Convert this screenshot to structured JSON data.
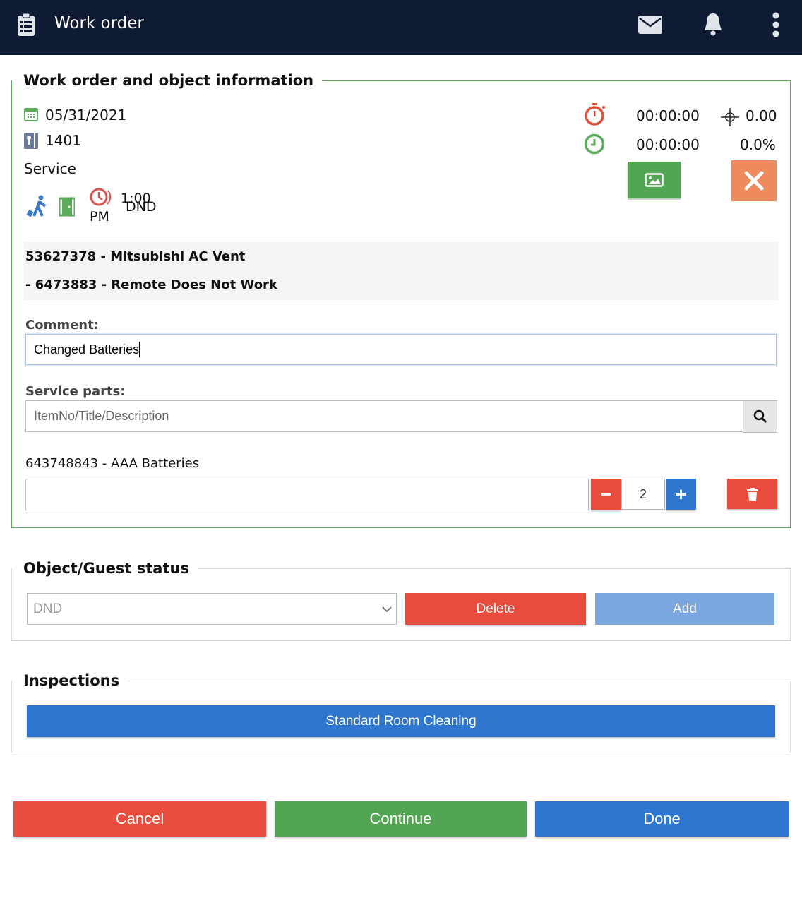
{
  "header": {
    "title": "Work order"
  },
  "info": {
    "legend": "Work order and object information",
    "date": "05/31/2021",
    "room": "1401",
    "type": "Service",
    "time": "1:00",
    "time_suffix": "PM",
    "status": "DND",
    "timer1": "00:00:00",
    "timer2": "00:00:00",
    "distance": "0.00",
    "percent": "0.0%",
    "item_line1": "53627378 - Mitsubishi AC Vent",
    "item_line2": "- 6473883 - Remote Does Not Work",
    "comment_label": "Comment:",
    "comment_value": "Changed Batteries",
    "parts_label": "Service parts:",
    "parts_placeholder": "ItemNo/Title/Description",
    "part_name": "643748843 - AAA Batteries",
    "part_qty": "2"
  },
  "status": {
    "legend": "Object/Guest status",
    "selected": "DND",
    "delete": "Delete",
    "add": "Add"
  },
  "inspections": {
    "legend": "Inspections",
    "item": "Standard Room Cleaning"
  },
  "footer": {
    "cancel": "Cancel",
    "continue": "Continue",
    "done": "Done"
  }
}
